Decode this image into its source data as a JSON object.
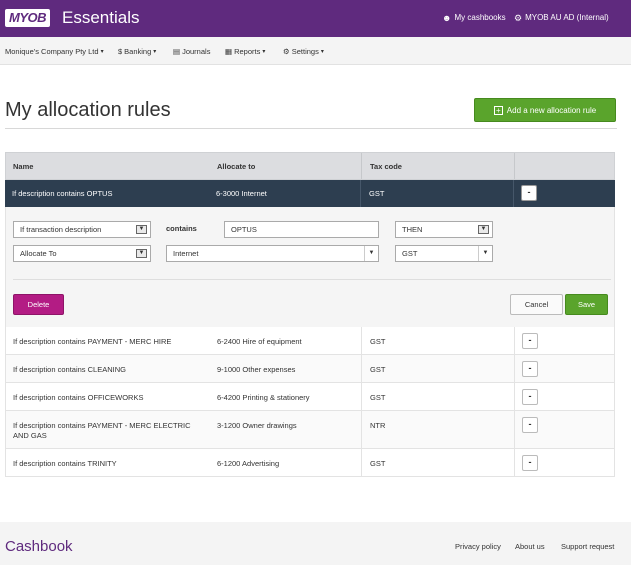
{
  "header": {
    "logo": "MYOB",
    "product": "Essentials",
    "my_cashbooks": "My cashbooks",
    "account": "MYOB AU AD (Internal)"
  },
  "nav": {
    "company": "Monique's Company Pty Ltd",
    "banking": "Banking",
    "journals": "Journals",
    "reports": "Reports",
    "settings": "Settings"
  },
  "page": {
    "title": "My allocation rules",
    "add_button": "Add a new allocation rule"
  },
  "table": {
    "headers": {
      "name": "Name",
      "allocate_to": "Allocate to",
      "tax_code": "Tax code"
    },
    "selected_row": {
      "name": "If description contains OPTUS",
      "allocate_to": "6-3000 Internet",
      "tax_code": "GST",
      "action": "-"
    },
    "rows": [
      {
        "name": "If description contains PAYMENT - MERC HIRE",
        "allocate_to": "6-2400 Hire of equipment",
        "tax_code": "GST",
        "action": "-"
      },
      {
        "name": "If description contains CLEANING",
        "allocate_to": "9-1000 Other expenses",
        "tax_code": "GST",
        "action": "-"
      },
      {
        "name": "If description contains OFFICEWORKS",
        "allocate_to": "6-4200 Printing & stationery",
        "tax_code": "GST",
        "action": "-"
      },
      {
        "name": "If description contains PAYMENT - MERC ELECTRIC AND GAS",
        "allocate_to": "3-1200 Owner drawings",
        "tax_code": "NTR",
        "action": "-"
      },
      {
        "name": "If description contains TRINITY",
        "allocate_to": "6-1200 Advertising",
        "tax_code": "GST",
        "action": "-"
      }
    ]
  },
  "editor": {
    "condition_field": "If transaction description",
    "contains_label": "contains",
    "contains_value": "OPTUS",
    "then_select": "THEN",
    "action_select": "Allocate To",
    "account_select": "Internet",
    "tax_select": "GST",
    "delete_button": "Delete",
    "cancel_button": "Cancel",
    "save_button": "Save"
  },
  "footer": {
    "brand": "Cashbook",
    "privacy": "Privacy policy",
    "about": "About us",
    "support": "Support request"
  }
}
